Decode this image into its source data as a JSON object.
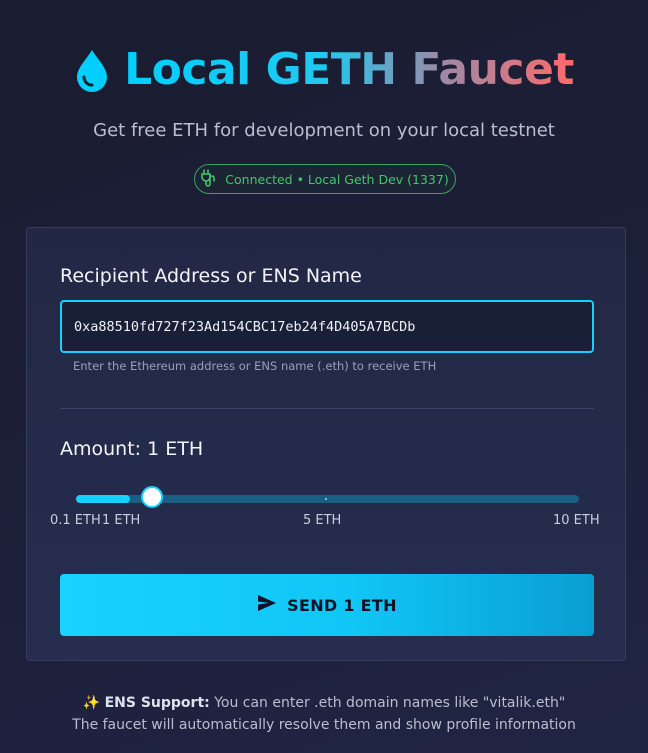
{
  "header": {
    "title": "Local GETH Faucet",
    "subtitle": "Get free ETH for development on your local testnet",
    "icon": "water-drop-icon"
  },
  "status": {
    "text": "Connected • Local Geth Dev (1337)",
    "icon": "plug-icon",
    "color": "#45c46c"
  },
  "form": {
    "address_label": "Recipient Address or ENS Name",
    "address_value": "0xa88510fd727f23Ad154CBC17eb24f4D405A7BCDb",
    "address_helper": "Enter the Ethereum address or ENS name (.eth) to receive ETH",
    "amount_label": "Amount: 1 ETH",
    "slider": {
      "min_label": "0.1 ETH",
      "current_label": "1 ETH",
      "mid_label": "5 ETH",
      "max_label": "10 ETH",
      "min": 0.1,
      "max": 10,
      "value": 1
    },
    "send_label": "SEND 1 ETH"
  },
  "footer": {
    "emoji": "✨",
    "ens_bold": "ENS Support:",
    "ens_text": " You can enter .eth domain names like \"vitalik.eth\"",
    "line2": "The faucet will automatically resolve them and show profile information"
  },
  "colors": {
    "accent": "#19cfff",
    "background": "#1c1f38",
    "card": "#242a48"
  }
}
